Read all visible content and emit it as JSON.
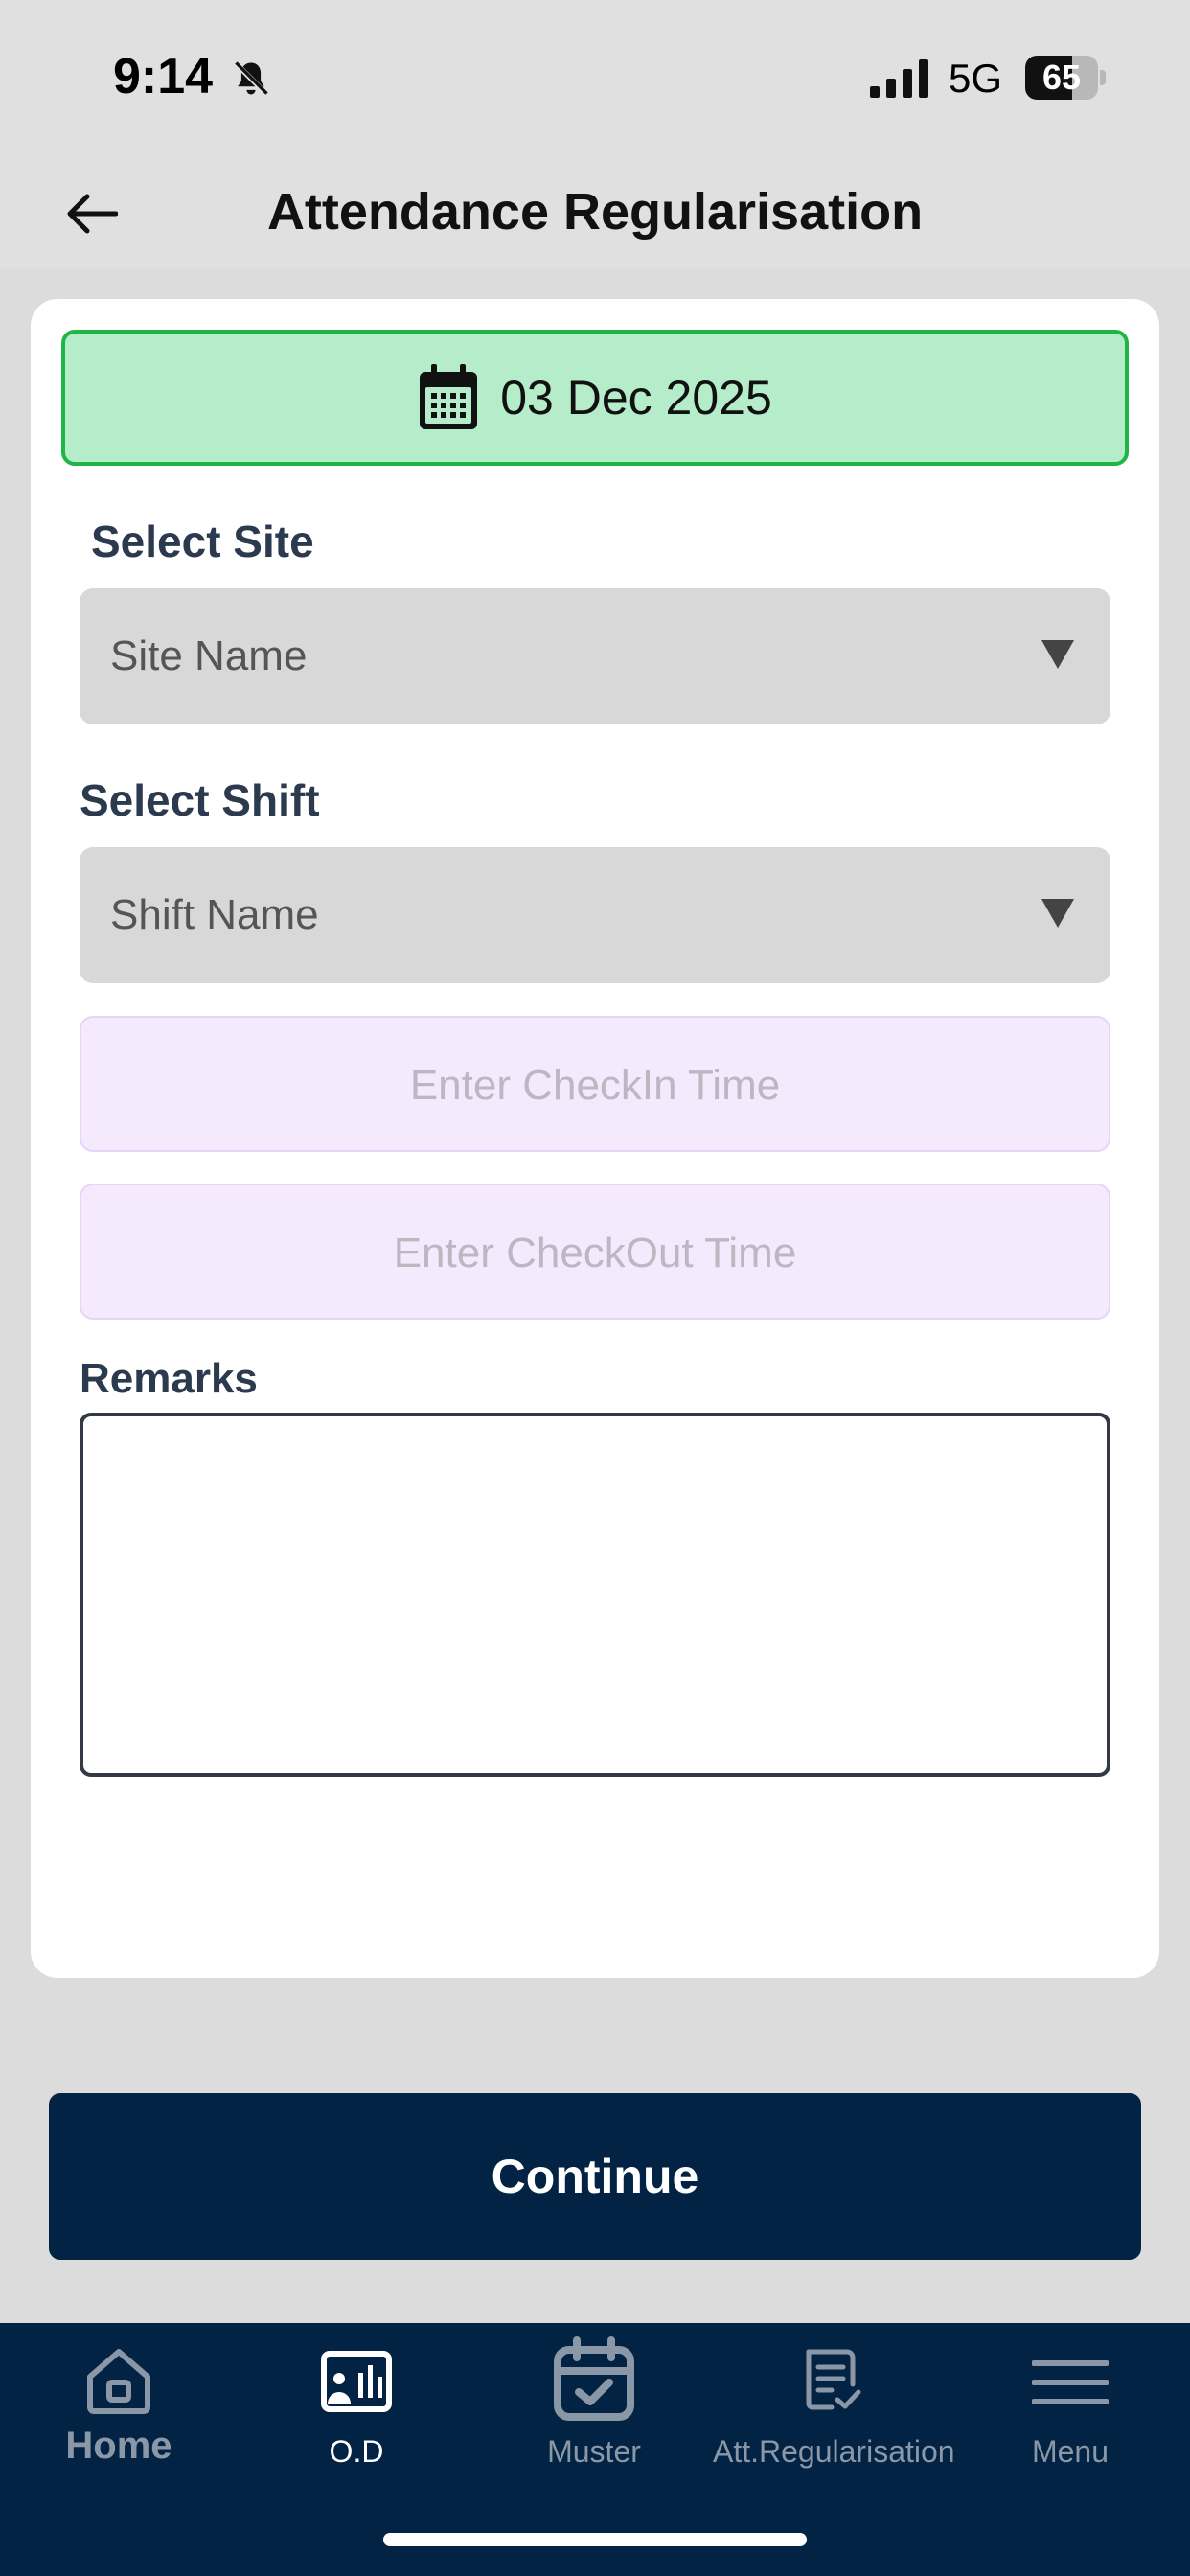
{
  "status_bar": {
    "time": "9:14",
    "network": "5G",
    "battery_percent": "65",
    "battery_level": 0.65
  },
  "header": {
    "title": "Attendance Regularisation"
  },
  "form": {
    "date": "03 Dec 2025",
    "site_label": "Select Site",
    "site_value": "Site Name",
    "shift_label": "Select Shift",
    "shift_value": "Shift Name",
    "checkin_placeholder": "Enter CheckIn Time",
    "checkout_placeholder": "Enter CheckOut Time",
    "remarks_label": "Remarks",
    "remarks_value": ""
  },
  "actions": {
    "continue_label": "Continue"
  },
  "bottom_nav": {
    "items": [
      {
        "label": "Home",
        "icon": "home-icon"
      },
      {
        "label": "O.D",
        "icon": "od-icon"
      },
      {
        "label": "Muster",
        "icon": "muster-calendar-icon"
      },
      {
        "label": "Att.Regularisation",
        "icon": "regularisation-doc-icon"
      },
      {
        "label": "Menu",
        "icon": "menu-icon"
      }
    ],
    "active_index": 1
  },
  "colors": {
    "primary": "#032344",
    "date_bg": "#b5ecc9",
    "date_border": "#1fb446",
    "input_bg": "#f5eafd"
  }
}
